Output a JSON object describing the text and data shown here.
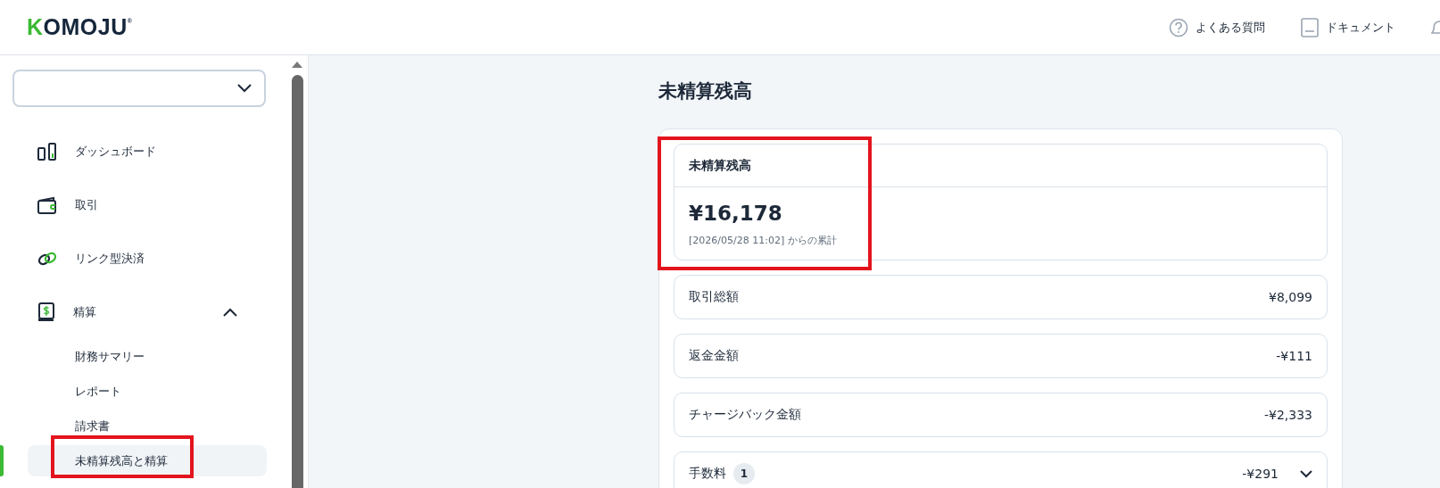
{
  "header": {
    "logo": "KOMOJU",
    "logo_mark": "®",
    "links": [
      {
        "label": "よくある質問"
      },
      {
        "label": "ドキュメント"
      }
    ]
  },
  "sidebar": {
    "items": [
      {
        "label": "ダッシュボード",
        "selected": false
      },
      {
        "label": "取引",
        "selected": false
      },
      {
        "label": "リンク型決済",
        "selected": false
      },
      {
        "label": "精算",
        "selected": false,
        "expanded": true,
        "children": [
          {
            "label": "財務サマリー",
            "selected": false,
            "highlighted": false
          },
          {
            "label": "レポート",
            "selected": false,
            "highlighted": false
          },
          {
            "label": "請求書",
            "selected": false,
            "highlighted": false
          },
          {
            "label": "未精算残高と精算",
            "selected": true,
            "highlighted": true
          }
        ]
      }
    ]
  },
  "main": {
    "title": "未精算残高",
    "summary": {
      "title": "未精算残高",
      "amount": "¥16,178",
      "note": "[2026/05/28 11:02] からの累計",
      "highlighted": true
    },
    "rows": [
      {
        "kind": "plain",
        "label": "取引総額",
        "value": "¥8,099"
      },
      {
        "kind": "plain",
        "label": "返金金額",
        "value": "-¥111"
      },
      {
        "kind": "plain",
        "label": "チャージバック金額",
        "value": "-¥2,333"
      },
      {
        "kind": "expandable",
        "label": "手数料",
        "count": "1",
        "value": "-¥291",
        "expanded": false
      }
    ]
  }
}
